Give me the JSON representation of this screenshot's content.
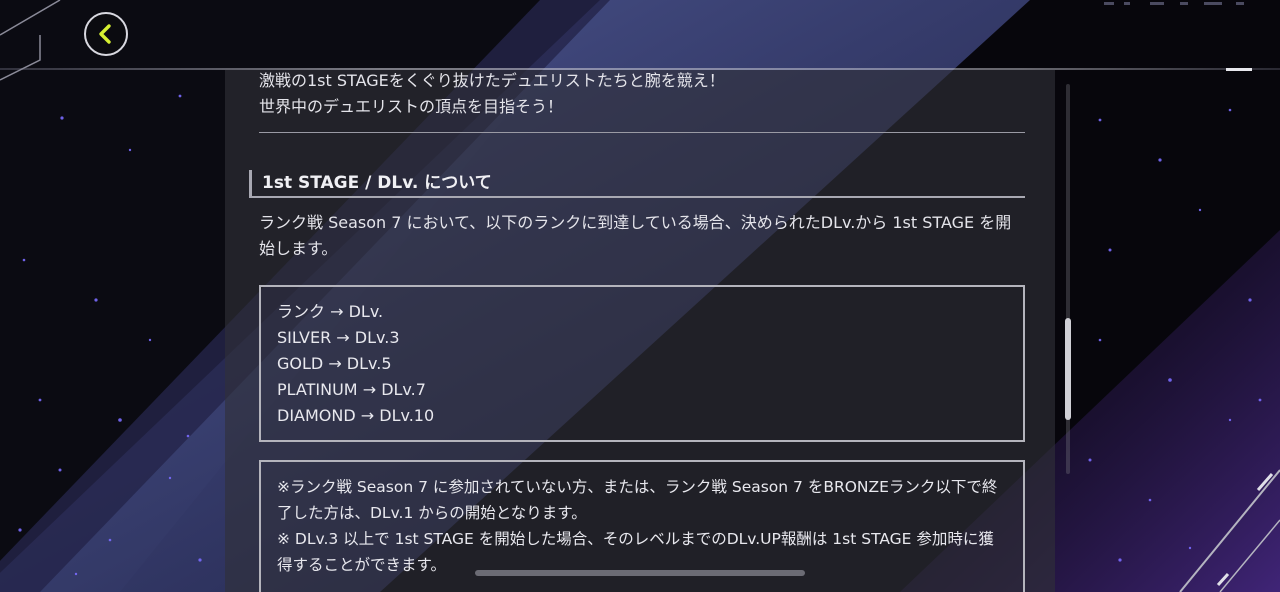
{
  "intro": {
    "line1": "激戦の1st STAGEをくぐり抜けたデュエリストたちと腕を競え！",
    "line2": "世界中のデュエリストの頂点を目指そう！"
  },
  "section": {
    "title": "1st STAGE / DLv. について",
    "description": "ランク戦 Season 7 において、以下のランクに到達している場合、決められたDLv.から 1st STAGE を開始します。"
  },
  "rank_table": {
    "rows": [
      "ランク → DLv.",
      "SILVER → DLv.3",
      "GOLD → DLv.5",
      "PLATINUM → DLv.7",
      "DIAMOND → DLv.10"
    ]
  },
  "notes": {
    "note1": "※ランク戦 Season 7 に参加されていない方、または、ランク戦 Season 7 をBRONZEランク以下で終了した方は、DLv.1 からの開始となります。",
    "note2": "※ DLv.3 以上で 1st STAGE を開始した場合、そのレベルまでのDLv.UP報酬は 1st STAGE 参加時に獲得することができます。"
  },
  "back_button": {
    "icon": "chevron-left-icon",
    "accent": "#d6f032"
  },
  "colors": {
    "background": "#07060c",
    "panel": "#303038",
    "beam": "#5a6ab8",
    "star": "#7a6cff"
  }
}
